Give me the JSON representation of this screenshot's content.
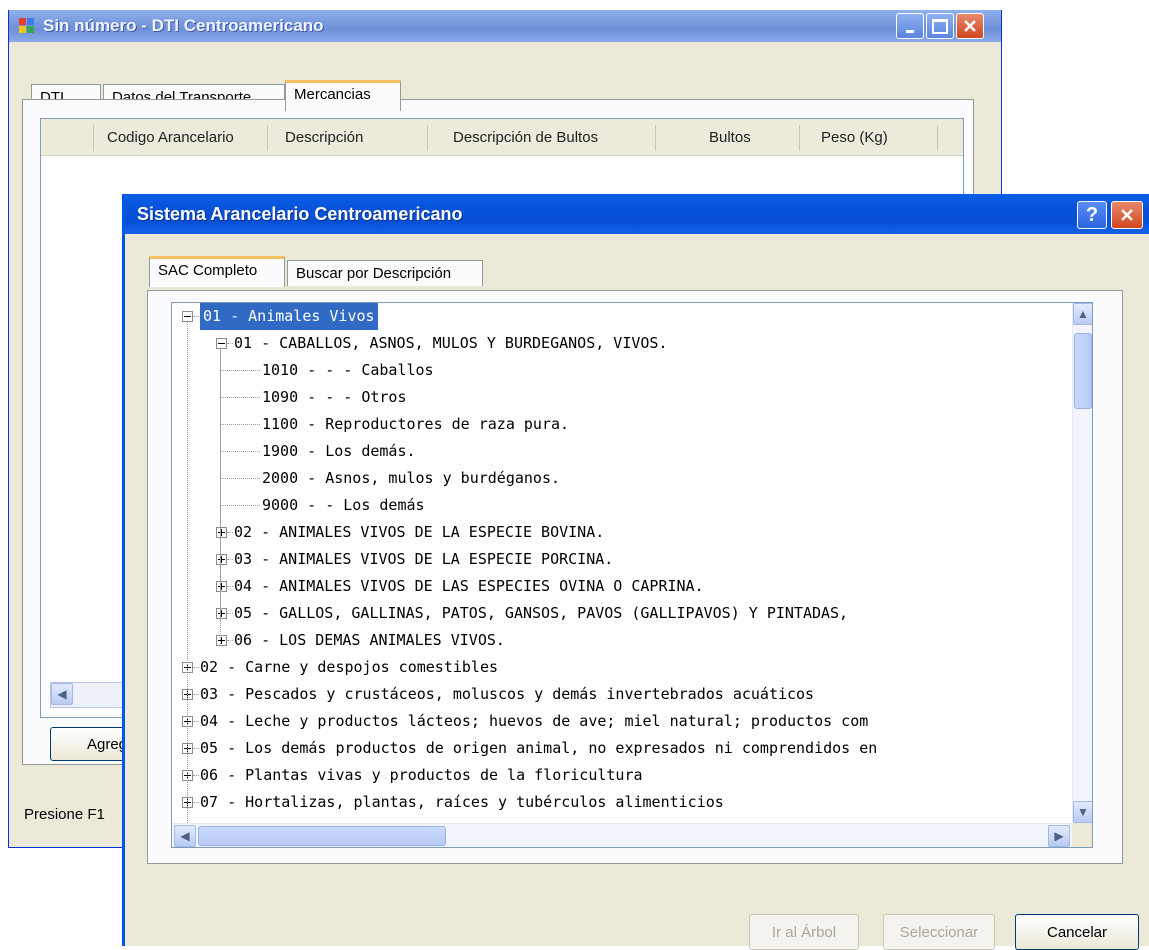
{
  "back_window": {
    "title": "Sin número - DTI Centroamericano",
    "tabs": [
      {
        "label": "DTI"
      },
      {
        "label": "Datos del Transporte"
      },
      {
        "label": "Mercancias",
        "active": true
      }
    ],
    "grid_columns": [
      "Codigo Arancelario",
      "Descripción",
      "Descripción de Bultos",
      "Bultos",
      "Peso (Kg)"
    ],
    "add_button_label": "Agreg",
    "status_text": "Presione F1"
  },
  "dialog": {
    "title": "Sistema Arancelario Centroamericano",
    "help_label": "?",
    "tabs": [
      {
        "label": "SAC Completo",
        "active": true
      },
      {
        "label": "Buscar por Descripción"
      }
    ],
    "tree": [
      {
        "text": "01 - Animales Vivos",
        "level": 0,
        "expander": "minus",
        "selected": true
      },
      {
        "text": "01 - CABALLOS, ASNOS, MULOS Y BURDEGANOS, VIVOS.",
        "level": 1,
        "expander": "minus"
      },
      {
        "text": "1010 - - - Caballos",
        "level": 2,
        "expander": "none"
      },
      {
        "text": "1090 - - - Otros",
        "level": 2,
        "expander": "none"
      },
      {
        "text": "1100 - Reproductores de raza pura.",
        "level": 2,
        "expander": "none"
      },
      {
        "text": "1900 - Los demás.",
        "level": 2,
        "expander": "none"
      },
      {
        "text": "2000 - Asnos, mulos y burdéganos.",
        "level": 2,
        "expander": "none"
      },
      {
        "text": "9000 - - Los demás",
        "level": 2,
        "expander": "none"
      },
      {
        "text": "02 - ANIMALES VIVOS DE LA ESPECIE BOVINA.",
        "level": 1,
        "expander": "plus"
      },
      {
        "text": "03 - ANIMALES VIVOS DE LA ESPECIE PORCINA.",
        "level": 1,
        "expander": "plus"
      },
      {
        "text": "04 - ANIMALES VIVOS DE LAS ESPECIES OVINA O CAPRINA.",
        "level": 1,
        "expander": "plus"
      },
      {
        "text": "05 - GALLOS,  GALLINAS, PATOS, GANSOS, PAVOS (GALLIPAVOS) Y  PINTADAS,",
        "level": 1,
        "expander": "plus"
      },
      {
        "text": "06 - LOS DEMAS ANIMALES VIVOS.",
        "level": 1,
        "expander": "plus"
      },
      {
        "text": "02 - Carne y despojos comestibles",
        "level": 0,
        "expander": "plus"
      },
      {
        "text": "03 - Pescados y crustáceos, moluscos y demás invertebrados acuáticos",
        "level": 0,
        "expander": "plus"
      },
      {
        "text": "04 - Leche y productos lácteos; huevos de ave; miel natural; productos  com",
        "level": 0,
        "expander": "plus"
      },
      {
        "text": "05 - Los demás productos de origen animal, no expresados ni comprendidos en",
        "level": 0,
        "expander": "plus"
      },
      {
        "text": "06 - Plantas vivas y productos de la floricultura",
        "level": 0,
        "expander": "plus"
      },
      {
        "text": "07 - Hortalizas, plantas, raíces y tubérculos alimenticios",
        "level": 0,
        "expander": "plus"
      }
    ],
    "buttons": {
      "tree_label": "Ir al Árbol",
      "select_label": "Seleccionar",
      "cancel_label": "Cancelar"
    }
  },
  "colors": {
    "selection": "#316ac5",
    "active_tab_accent": "#f7c261",
    "dialog_title_bar": "#0a5fe8"
  }
}
